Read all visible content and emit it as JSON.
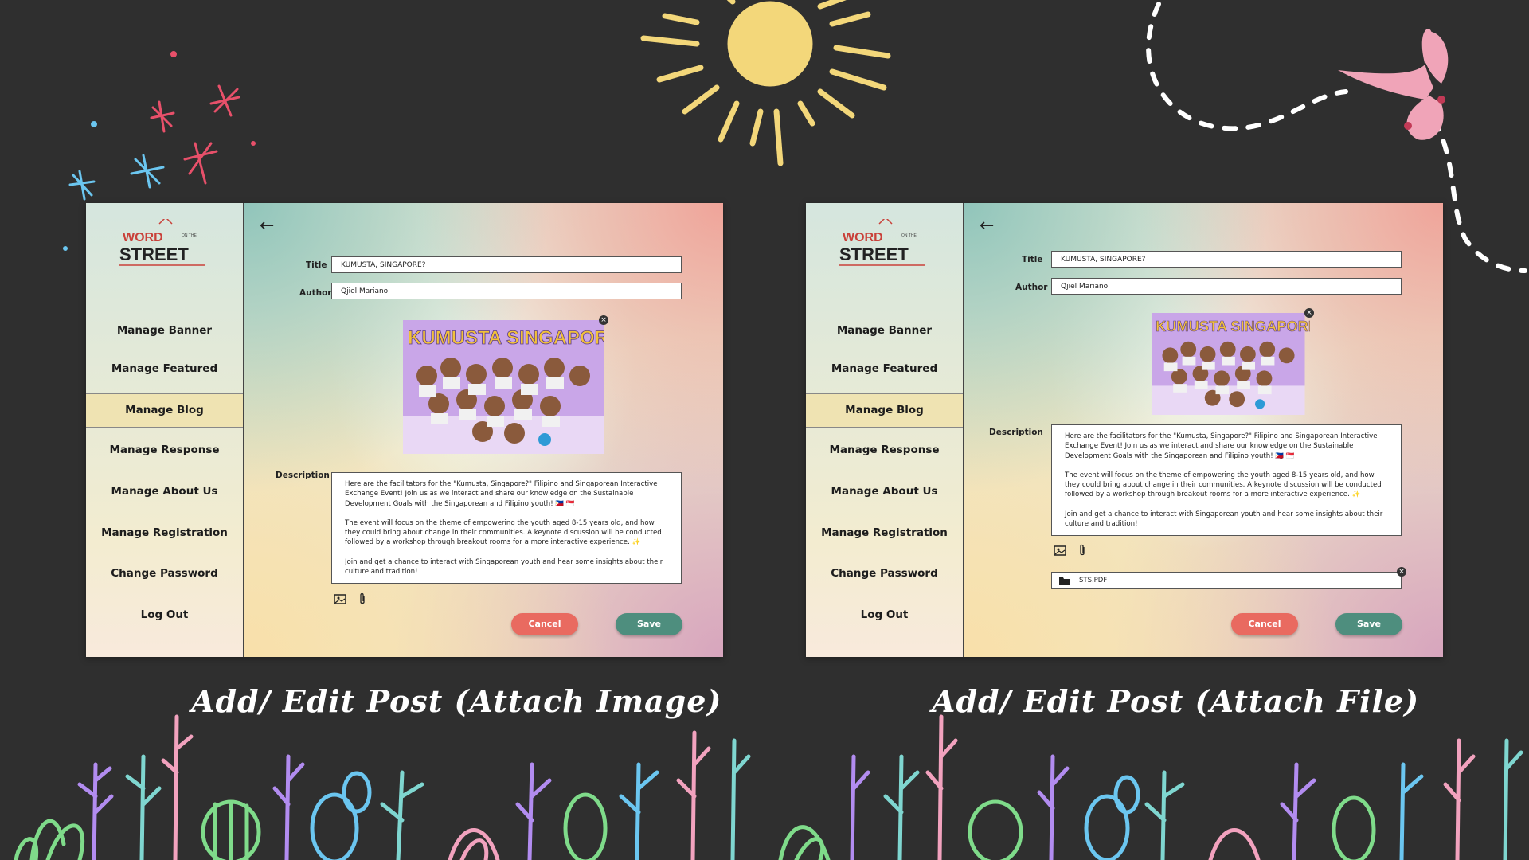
{
  "colors": {
    "background": "#2f2f2f",
    "cancel": "#e96a60",
    "save": "#4e8e7e",
    "active_nav": "#efe3b2"
  },
  "logo": {
    "line1": "WORD",
    "small": "ON THE",
    "line2": "STREET"
  },
  "nav": [
    "Manage Banner",
    "Manage Featured",
    "Manage Blog",
    "Manage Response",
    "Manage About Us",
    "Manage Registration",
    "Change Password",
    "Log Out"
  ],
  "active_nav": "Manage Blog",
  "form": {
    "back": "←",
    "title_label": "Title",
    "title_value": "KUMUSTA, SINGAPORE?",
    "author_label": "Author",
    "author_value": "Qjiel Mariano",
    "description_label": "Description",
    "description": [
      "Here are the facilitators for the \"Kumusta, Singapore?\" Filipino and Singaporean Interactive Exchange Event! Join us as we interact and share our knowledge on the Sustainable Development Goals with the Singaporean and Filipino youth! 🇵🇭 🇸🇬",
      "The event will focus on the theme of empowering the youth aged 8-15 years old, and how they could bring about change in their communities.  A keynote discussion will be conducted followed by a workshop through breakout rooms for a more interactive experience. ✨",
      "Join and get a chance to interact with Singaporean youth and hear some insights about their culture and tradition!"
    ],
    "poster_text": "KUMUSTA SINGAPORE?",
    "cancel": "Cancel",
    "save": "Save",
    "file_name": "STS.PDF"
  },
  "icons": {
    "back": "arrow-left-icon",
    "image": "image-icon",
    "attach": "paperclip-icon",
    "folder": "folder-icon",
    "remove": "close-icon"
  },
  "captions": {
    "left": "Add/ Edit Post (Attach Image)",
    "right": "Add/ Edit Post (Attach File)"
  }
}
